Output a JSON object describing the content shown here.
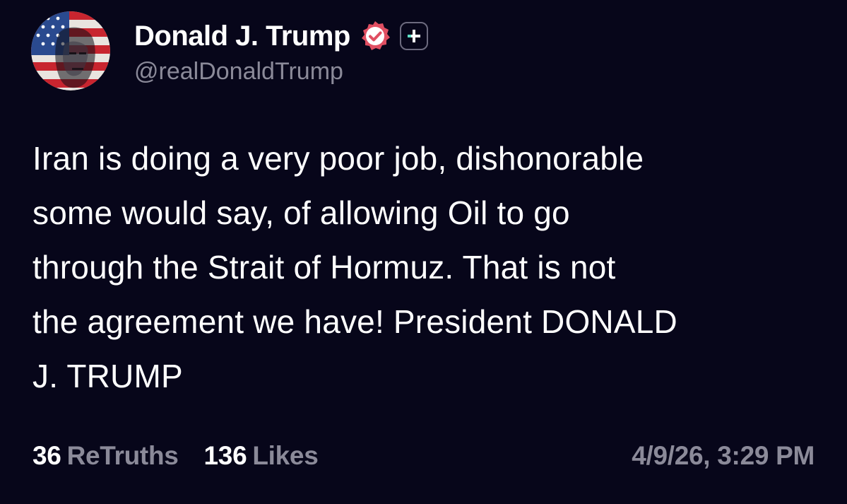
{
  "author": {
    "display_name": "Donald J. Trump",
    "handle": "@realDonaldTrump",
    "avatar_icon": "flag-portrait-avatar",
    "verified_icon": "verified-badge-icon",
    "plus_icon": "plus-subscription-icon"
  },
  "post": {
    "text": "Iran is doing a very poor job, dishonorable\nsome would say, of allowing Oil to go\nthrough the Strait of Hormuz. That is not\nthe agreement we have! President DONALD\nJ. TRUMP"
  },
  "stats": {
    "retruths_count": "36",
    "retruths_label": "ReTruths",
    "likes_count": "136",
    "likes_label": "Likes"
  },
  "timestamp": "4/9/26, 3:29 PM",
  "colors": {
    "background": "#07061a",
    "primary_text": "#ffffff",
    "secondary_text": "#8b8a99",
    "verified_badge": "#e04f62",
    "plus_accent": "#5ee0c6"
  }
}
